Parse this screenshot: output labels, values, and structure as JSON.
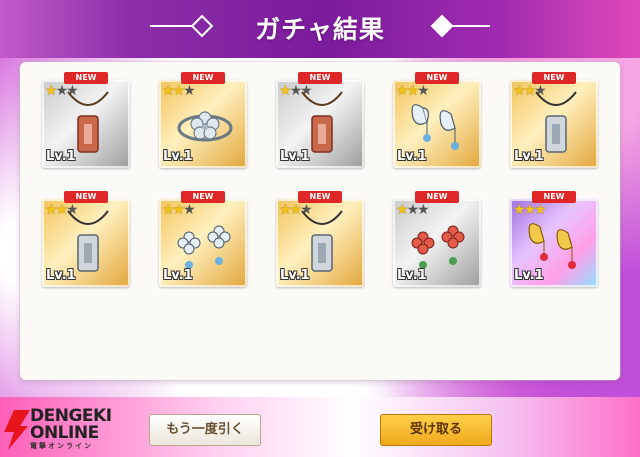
{
  "header": {
    "title": "ガチャ結果"
  },
  "items": [
    {
      "new": "NEW",
      "stars": 1,
      "rarity": "r2",
      "lv": "Lv.1",
      "icon": "necklace-tag-bronze-icon"
    },
    {
      "new": "NEW",
      "stars": 2,
      "rarity": "r3",
      "lv": "Lv.1",
      "icon": "bracelet-flower-icon"
    },
    {
      "new": "NEW",
      "stars": 1,
      "rarity": "r2",
      "lv": "Lv.1",
      "icon": "necklace-tag-bronze-icon"
    },
    {
      "new": "NEW",
      "stars": 2,
      "rarity": "r3",
      "lv": "Lv.1",
      "icon": "earrings-butterfly-icon"
    },
    {
      "new": "NEW",
      "stars": 2,
      "rarity": "r3",
      "lv": "Lv.1",
      "icon": "necklace-tag-silver-icon"
    },
    {
      "new": "NEW",
      "stars": 2,
      "rarity": "r3",
      "lv": "Lv.1",
      "icon": "necklace-tag-silver-icon"
    },
    {
      "new": "NEW",
      "stars": 2,
      "rarity": "r3",
      "lv": "Lv.1",
      "icon": "earrings-flower-silver-icon"
    },
    {
      "new": "NEW",
      "stars": 2,
      "rarity": "r3",
      "lv": "Lv.1",
      "icon": "necklace-tag-silver-icon"
    },
    {
      "new": "NEW",
      "stars": 1,
      "rarity": "r2",
      "lv": "Lv.1",
      "icon": "earrings-flower-red-icon"
    },
    {
      "new": "NEW",
      "stars": 3,
      "rarity": "r4",
      "lv": "Lv.1",
      "icon": "earrings-butterfly-gold-icon"
    }
  ],
  "buttons": {
    "again": "もう一度引く",
    "receive": "受け取る"
  },
  "logo": {
    "line1": "DENGEKI",
    "line2": "ONLINE",
    "sub": "電撃オンライン"
  },
  "colors": {
    "header": "#7a1c9c",
    "new_badge": "#e02727",
    "star": "#f3c218",
    "receive_button": "#f0a91c"
  }
}
